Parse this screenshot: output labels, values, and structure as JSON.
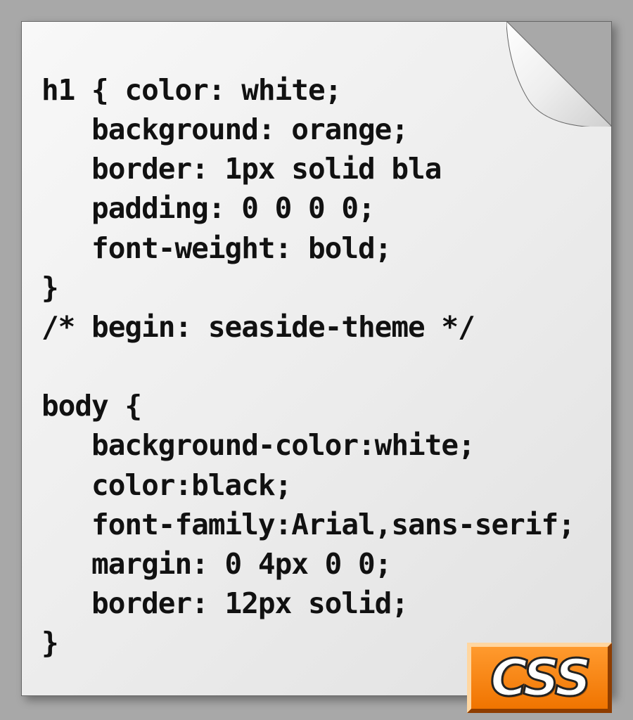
{
  "file": {
    "code_text": "h1 { color: white;\n   background: orange;\n   border: 1px solid bla\n   padding: 0 0 0 0;\n   font-weight: bold;\n}\n/* begin: seaside-theme */\n\nbody {\n   background-color:white;\n   color:black;\n   font-family:Arial,sans-serif;\n   margin: 0 4px 0 0;\n   border: 12px solid;\n}"
  },
  "badge": {
    "label": "CSS"
  }
}
